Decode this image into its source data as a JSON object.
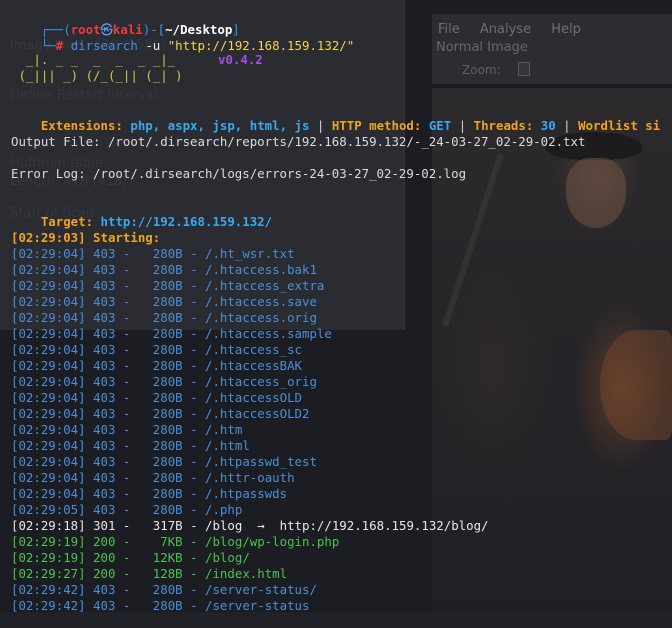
{
  "background": {
    "menu": [
      "File",
      "Analyse",
      "Help"
    ],
    "normal_image": "Normal Image",
    "zoom_label": "Zoom:"
  },
  "prompt": {
    "frame_top_left": "┌──(",
    "user": "root",
    "at": "㉿",
    "host": "kali",
    "frame_mid": ")-[",
    "cwd": "~/Desktop",
    "frame_close": "]",
    "frame_bottom": "└─",
    "hash": "#",
    "command": "dirsearch",
    "flag": "-u",
    "url": "\"http://192.168.159.132/\""
  },
  "logo": {
    "line1": "  _|. _ _  _  _  _ _|_",
    "line2": " (_||| _) (/_(_|| (_| )",
    "version": "v0.4.2"
  },
  "config": {
    "extensions_label": "Extensions:",
    "extensions_value": "php, aspx, jsp, html, js",
    "method_label": "HTTP method:",
    "method_value": "GET",
    "threads_label": "Threads:",
    "threads_value": "30",
    "wordlist_label": "Wordlist si",
    "separator": "|"
  },
  "output_file": "Output File: /root/.dirsearch/reports/192.168.159.132/-_24-03-27_02-29-02.txt",
  "error_log": "Error Log: /root/.dirsearch/logs/errors-24-03-27_02-29-02.log",
  "target_label": "Target:",
  "target_value": "http://192.168.159.132/",
  "starting": "[02:29:03] Starting:",
  "results": [
    {
      "time": "[02:29:04]",
      "code": "403",
      "size": "280B",
      "path": "/.ht_wsr.txt",
      "redirect": ""
    },
    {
      "time": "[02:29:04]",
      "code": "403",
      "size": "280B",
      "path": "/.htaccess.bak1",
      "redirect": ""
    },
    {
      "time": "[02:29:04]",
      "code": "403",
      "size": "280B",
      "path": "/.htaccess_extra",
      "redirect": ""
    },
    {
      "time": "[02:29:04]",
      "code": "403",
      "size": "280B",
      "path": "/.htaccess.save",
      "redirect": ""
    },
    {
      "time": "[02:29:04]",
      "code": "403",
      "size": "280B",
      "path": "/.htaccess.orig",
      "redirect": ""
    },
    {
      "time": "[02:29:04]",
      "code": "403",
      "size": "280B",
      "path": "/.htaccess.sample",
      "redirect": ""
    },
    {
      "time": "[02:29:04]",
      "code": "403",
      "size": "280B",
      "path": "/.htaccess_sc",
      "redirect": ""
    },
    {
      "time": "[02:29:04]",
      "code": "403",
      "size": "280B",
      "path": "/.htaccessBAK",
      "redirect": ""
    },
    {
      "time": "[02:29:04]",
      "code": "403",
      "size": "280B",
      "path": "/.htaccess_orig",
      "redirect": ""
    },
    {
      "time": "[02:29:04]",
      "code": "403",
      "size": "280B",
      "path": "/.htaccessOLD",
      "redirect": ""
    },
    {
      "time": "[02:29:04]",
      "code": "403",
      "size": "280B",
      "path": "/.htaccessOLD2",
      "redirect": ""
    },
    {
      "time": "[02:29:04]",
      "code": "403",
      "size": "280B",
      "path": "/.htm",
      "redirect": ""
    },
    {
      "time": "[02:29:04]",
      "code": "403",
      "size": "280B",
      "path": "/.html",
      "redirect": ""
    },
    {
      "time": "[02:29:04]",
      "code": "403",
      "size": "280B",
      "path": "/.htpasswd_test",
      "redirect": ""
    },
    {
      "time": "[02:29:04]",
      "code": "403",
      "size": "280B",
      "path": "/.httr-oauth",
      "redirect": ""
    },
    {
      "time": "[02:29:04]",
      "code": "403",
      "size": "280B",
      "path": "/.htpasswds",
      "redirect": ""
    },
    {
      "time": "[02:29:05]",
      "code": "403",
      "size": "280B",
      "path": "/.php",
      "redirect": ""
    },
    {
      "time": "[02:29:18]",
      "code": "301",
      "size": "317B",
      "path": "/blog",
      "redirect": "→  http://192.168.159.132/blog/"
    },
    {
      "time": "[02:29:19]",
      "code": "200",
      "size": "7KB",
      "path": "/blog/wp-login.php",
      "redirect": ""
    },
    {
      "time": "[02:29:19]",
      "code": "200",
      "size": "12KB",
      "path": "/blog/",
      "redirect": ""
    },
    {
      "time": "[02:29:27]",
      "code": "200",
      "size": "128B",
      "path": "/index.html",
      "redirect": ""
    },
    {
      "time": "[02:29:42]",
      "code": "403",
      "size": "280B",
      "path": "/server-status/",
      "redirect": ""
    },
    {
      "time": "[02:29:42]",
      "code": "403",
      "size": "280B",
      "path": "/server-status",
      "redirect": ""
    }
  ],
  "ghost_text": {
    "g1": "Image lines: 632 (1586)",
    "g2": "Define Restart Interval",
    "g3": "Huffman table",
    "g4": "Length: 418 (418)",
    "g5": "Start of Scan"
  }
}
